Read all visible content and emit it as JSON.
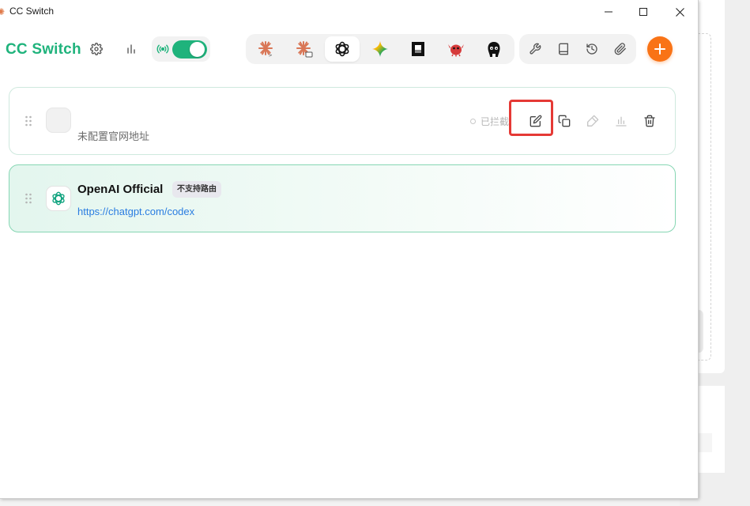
{
  "window": {
    "title": "CC Switch",
    "controls": {
      "minimize": "minimize-icon",
      "maximize": "maximize-icon",
      "close": "close-icon"
    }
  },
  "header": {
    "brand": "CC Switch",
    "settings_icon": "gear-icon",
    "stats_icon": "bar-chart-icon",
    "proxy": {
      "icon": "broadcast-icon",
      "enabled": true,
      "accent": "#1fb37c"
    },
    "apps": [
      {
        "id": "claude-code",
        "icon": "claude-code-icon",
        "active": false
      },
      {
        "id": "claude-desktop",
        "icon": "claude-desktop-icon",
        "active": false
      },
      {
        "id": "codex",
        "icon": "openai-icon",
        "active": true
      },
      {
        "id": "gemini",
        "icon": "gemini-icon",
        "active": false
      },
      {
        "id": "opencode",
        "icon": "opencode-icon",
        "active": false
      },
      {
        "id": "openclaw",
        "icon": "openclaw-icon",
        "active": false
      },
      {
        "id": "other",
        "icon": "agent-avatar-icon",
        "active": false
      }
    ],
    "tools": [
      {
        "icon": "wrench-icon"
      },
      {
        "icon": "book-icon"
      },
      {
        "icon": "history-icon"
      },
      {
        "icon": "paperclip-icon"
      }
    ],
    "add_button": {
      "icon": "plus-icon",
      "color": "#f97316"
    }
  },
  "providers": [
    {
      "name": "",
      "subtitle": "未配置官网地址",
      "status": "已拦截",
      "actions": [
        "edit-icon",
        "copy-icon",
        "test-icon",
        "usage-icon",
        "trash-icon"
      ]
    },
    {
      "name": "OpenAI Official",
      "badge": "不支持路由",
      "link": "https://chatgpt.com/codex",
      "icon": "openai-icon",
      "active": true
    }
  ]
}
